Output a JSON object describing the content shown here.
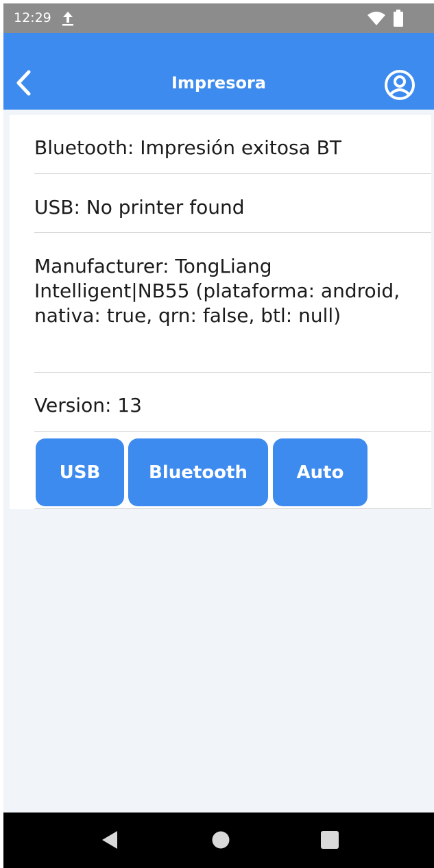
{
  "status_bar": {
    "time": "12:29",
    "icons": [
      "upload-icon",
      "wifi-icon",
      "battery-icon"
    ]
  },
  "app_bar": {
    "title": "Impresora",
    "back_icon": "chevron-left-icon",
    "account_icon": "account-circle-icon",
    "color": "#3d8bef"
  },
  "printer_info": {
    "bluetooth": "Bluetooth: Impresión exitosa BT",
    "usb": "USB: No printer found",
    "manufacturer": "Manufacturer: TongLiang Intelligent|NB55 (plataforma: android, nativa: true, qrn: false, btl: null)",
    "version": "Version: 13"
  },
  "mode_buttons": [
    {
      "label": "USB"
    },
    {
      "label": "Bluetooth"
    },
    {
      "label": "Auto"
    }
  ],
  "nav_bar": {
    "icons": [
      "triangle-back-icon",
      "circle-home-icon",
      "square-recents-icon"
    ]
  }
}
